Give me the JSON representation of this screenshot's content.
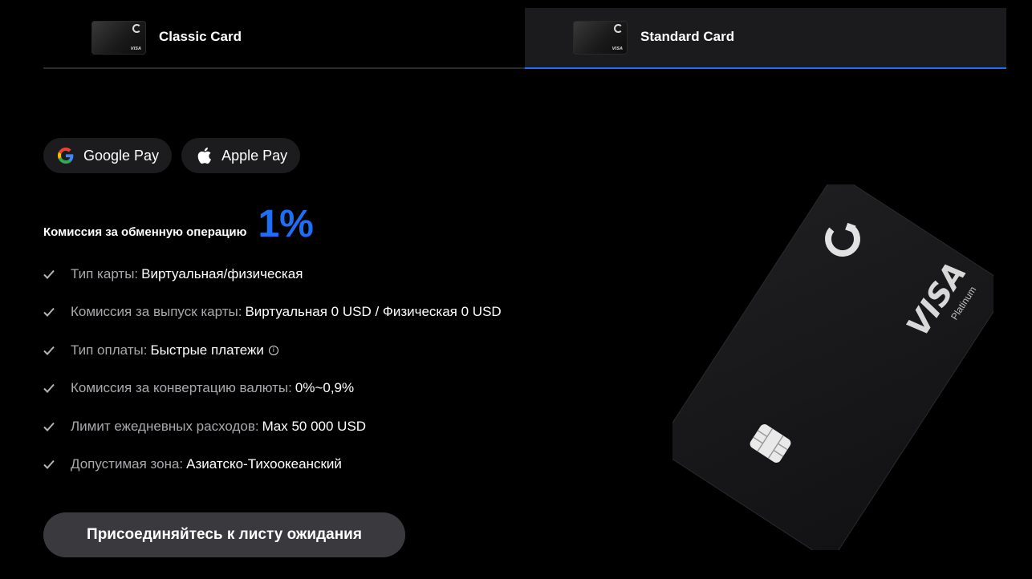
{
  "tabs": [
    {
      "label": "Classic Card",
      "active": false
    },
    {
      "label": "Standard Card",
      "active": true
    }
  ],
  "thumb": {
    "brand": "VISA"
  },
  "payments": [
    {
      "label": "Google Pay",
      "icon": "google-icon"
    },
    {
      "label": "Apple Pay",
      "icon": "apple-icon"
    }
  ],
  "fee": {
    "label": "Комиссия за обменную операцию",
    "value": "1%"
  },
  "features": [
    {
      "key": "Тип карты:",
      "value": "Виртуальная/физическая"
    },
    {
      "key": "Комиссия за выпуск карты:",
      "value": "Виртуальная 0 USD / Физическая 0 USD"
    },
    {
      "key": "Тип оплаты:",
      "value": "Быстрые платежи",
      "info": "i"
    },
    {
      "key": "Комиссия за конвертацию валюты:",
      "value": "0%~0,9%"
    },
    {
      "key": "Лимит ежедневных расходов:",
      "value": "Max 50 000 USD"
    },
    {
      "key": "Допустимая зона:",
      "value": "Азиатско-Тихоокеанский"
    }
  ],
  "cta": {
    "label": "Присоединяйтесь к листу ожидания"
  },
  "card": {
    "brand": "VISA",
    "tier": "Platinum"
  },
  "colors": {
    "accent": "#1e6ff5",
    "background": "#000000",
    "pill": "#1c1c1e",
    "button": "#3a3a3e"
  }
}
